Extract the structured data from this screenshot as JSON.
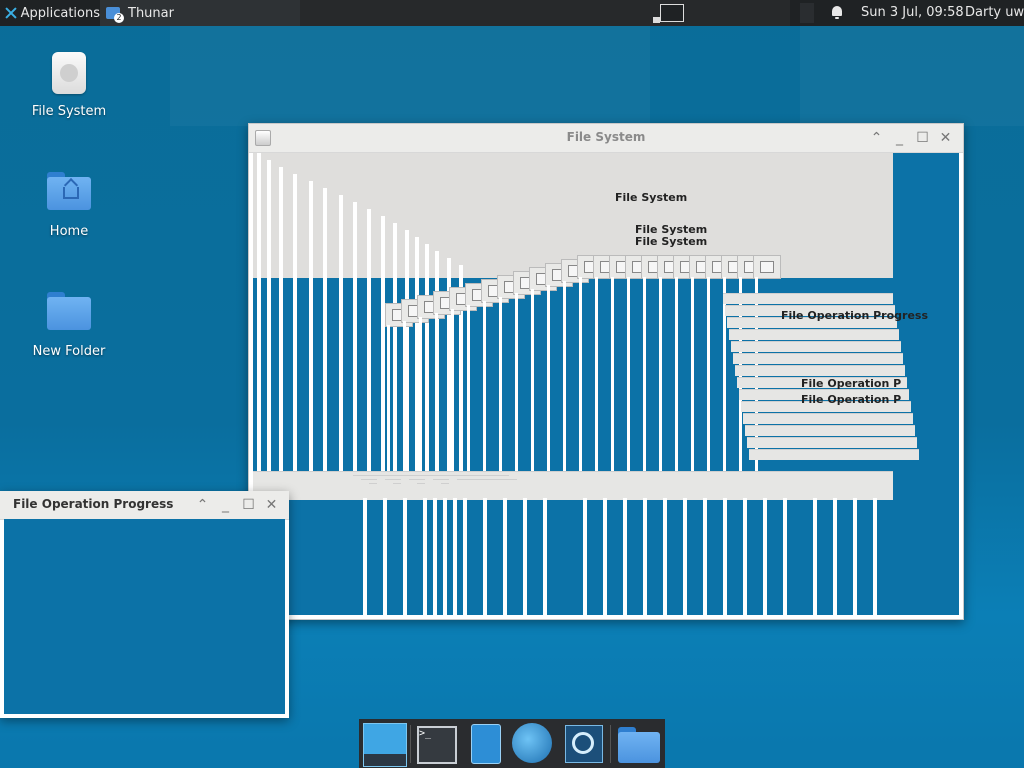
{
  "top_panel": {
    "applications_label": "Applications",
    "task_label": "Thunar",
    "task_badge": "2",
    "clock": "Sun  3 Jul, 09:58",
    "user": "Darty uwu"
  },
  "desktop": {
    "icons": [
      {
        "label": "File System",
        "icon": "drive-icon"
      },
      {
        "label": "Home",
        "icon": "home-folder-icon"
      },
      {
        "label": "New Folder",
        "icon": "folder-icon"
      }
    ]
  },
  "fs_window": {
    "title": "File System",
    "ghost_texts": [
      "File System",
      "File System",
      "File System",
      "File Operation Progress",
      "File Operation P",
      "File Operation P"
    ]
  },
  "fop_window": {
    "title": "File Operation Progress"
  },
  "dock": {
    "terminal_prompt": ">_"
  },
  "colors": {
    "wallpaper": "#0a6d99",
    "panel": "#1f2224",
    "accent": "#3ab0e5"
  }
}
